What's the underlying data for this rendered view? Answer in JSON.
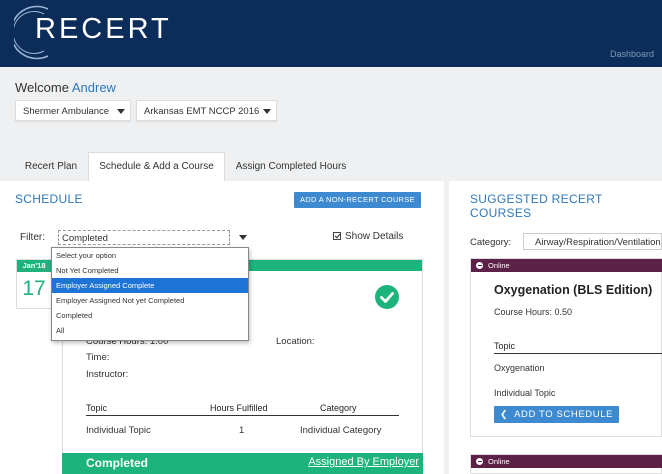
{
  "header": {
    "logo_text": "RECERT",
    "dashboard_link": "Dashboard"
  },
  "welcome": {
    "prefix": "Welcome",
    "name": "Andrew"
  },
  "selects": {
    "agency": "Shermer Ambulance",
    "certification": "Arkansas EMT NCCP 2016"
  },
  "tabs": [
    {
      "label": "Recert Plan",
      "active": false
    },
    {
      "label": "Schedule & Add a Course",
      "active": true
    },
    {
      "label": "Assign Completed Hours",
      "active": false
    }
  ],
  "schedule": {
    "title": "SCHEDULE",
    "add_button": "ADD A NON-RECERT COURSE",
    "filter_label": "Filter:",
    "filter_value": "Completed",
    "show_details_label": "Show Details",
    "show_details_checked": true,
    "filter_options": [
      {
        "label": "Select your option",
        "highlighted": false
      },
      {
        "label": "Not Yet Completed",
        "highlighted": false
      },
      {
        "label": "Employer Assigned Complete",
        "highlighted": true
      },
      {
        "label": "Employer Assigned Not yet Completed",
        "highlighted": false
      },
      {
        "label": "Completed",
        "highlighted": false
      },
      {
        "label": "All",
        "highlighted": false
      }
    ]
  },
  "course": {
    "date_month": "Jan'18",
    "date_day": "17",
    "course_hours": "Course Hours: 1.00",
    "location": "Location:",
    "time": "Time:",
    "instructor": "Instructor:",
    "table_headers": [
      "Topic",
      "Hours Fulfilled",
      "Category"
    ],
    "rows": [
      {
        "topic": "Individual Topic",
        "hours": "1",
        "category": "Individual Category"
      }
    ],
    "status": "Completed",
    "assigned_link": "Assigned By Employer",
    "accent_color": "#1cb37c"
  },
  "suggested": {
    "title": "SUGGESTED RECERT COURSES",
    "category_label": "Category:",
    "category_value": "Airway/Respiration/Ventilation",
    "cards": [
      {
        "badge": "Online",
        "title": "Oxygenation (BLS Edition)",
        "course_hours": "Course Hours: 0.50",
        "topic_header": "Topic",
        "topic": "Oxygenation",
        "individual_topic": "Individual Topic",
        "add_button": "ADD TO SCHEDULE"
      },
      {
        "badge": "Online"
      }
    ],
    "badge_color": "#5c2146"
  },
  "colors": {
    "header_bg": "#0c2d5a",
    "primary": "#3d8ad0",
    "link": "#2f78b8"
  }
}
